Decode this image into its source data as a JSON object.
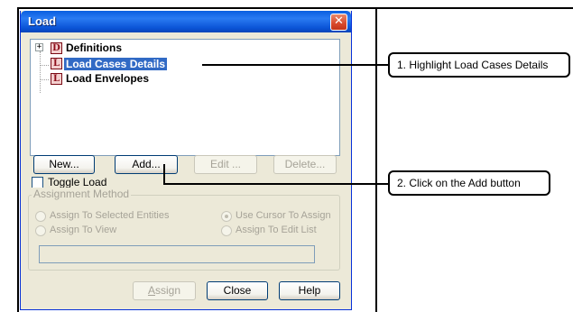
{
  "dialog": {
    "title": "Load",
    "close_symbol": "✕",
    "tree": {
      "items": [
        {
          "label": "Definitions",
          "icon_letter": "D",
          "expander": "+",
          "selected": false,
          "icon": "definitions-icon"
        },
        {
          "label": "Load Cases Details",
          "icon_letter": "L",
          "selected": true,
          "icon": "load-case-icon"
        },
        {
          "label": "Load Envelopes",
          "icon_letter": "L",
          "selected": false,
          "icon": "load-envelope-icon"
        }
      ]
    },
    "buttons": {
      "new": "New...",
      "add": "Add...",
      "edit": "Edit ...",
      "delete": "Delete..."
    },
    "toggle_load_label": "Toggle Load",
    "assignment": {
      "legend": "Assignment Method",
      "options": [
        {
          "label": "Assign To Selected Entities",
          "checked": false
        },
        {
          "label": "Use Cursor To Assign",
          "checked": true
        },
        {
          "label": "Assign To View",
          "checked": false
        },
        {
          "label": "Assign To Edit List",
          "checked": false
        }
      ],
      "text_value": ""
    },
    "footer_buttons": {
      "assign_first": "A",
      "assign_rest": "ssign",
      "close": "Close",
      "help": "Help"
    }
  },
  "callouts": {
    "step1": "1. Highlight Load Cases Details",
    "step2": "2. Click on the Add button"
  },
  "colors": {
    "titlebar": "#0a5fe0",
    "selection": "#316ac5",
    "dialog_bg": "#ece9d8",
    "icon_red": "#8d0d1a"
  }
}
